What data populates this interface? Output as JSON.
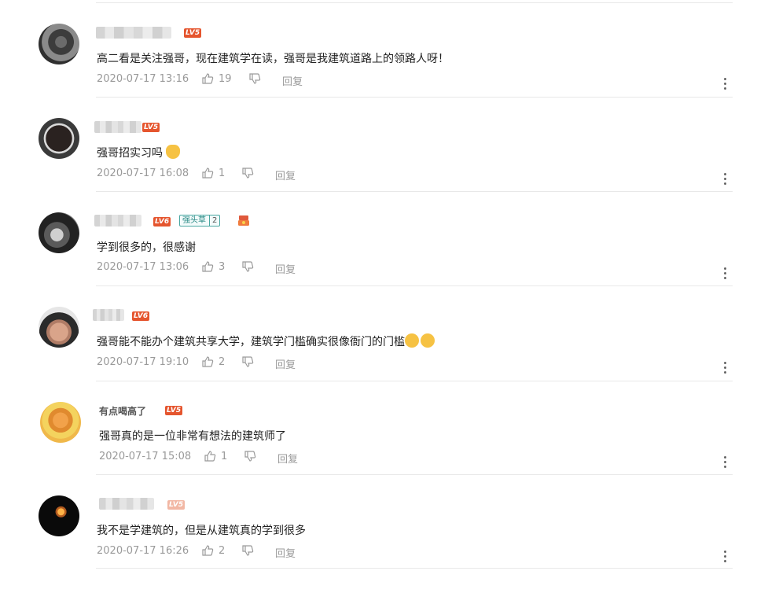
{
  "comments": [
    {
      "name": "",
      "level": "LV5",
      "text": "高二看是关注强哥，现在建筑学在读，强哥是我建筑道路上的领路人呀！",
      "time": "2020-07-17 13:16",
      "likes": "19",
      "reply": "回复"
    },
    {
      "name": "",
      "level": "LV5",
      "text": "强哥招实习吗",
      "time": "2020-07-17 16:08",
      "likes": "1",
      "reply": "回复"
    },
    {
      "name": "",
      "level": "LV6",
      "badge": "强头草",
      "badge_level": "2",
      "text": "学到很多的，很感谢",
      "time": "2020-07-17 13:06",
      "likes": "3",
      "reply": "回复"
    },
    {
      "name": "",
      "level": "LV6",
      "text": "强哥能不能办个建筑共享大学，建筑学门槛确实很像衙门的门槛",
      "time": "2020-07-17 19:10",
      "likes": "2",
      "reply": "回复"
    },
    {
      "name": "有点喝高了",
      "level": "LV5",
      "text": "强哥真的是一位非常有想法的建筑师了",
      "time": "2020-07-17 15:08",
      "likes": "1",
      "reply": "回复"
    },
    {
      "name": "",
      "level": "LV5",
      "text": "我不是学建筑的，但是从建筑真的学到很多",
      "time": "2020-07-17 16:26",
      "likes": "2",
      "reply": "回复"
    }
  ],
  "icons": {
    "like": "thumbs-up-icon",
    "dislike": "thumbs-down-icon",
    "more": "more-vertical-icon"
  },
  "colors": {
    "level_badge": "#e5552e",
    "meta_text": "#9a9a9a",
    "badge_teal": "#4aa7a2"
  }
}
